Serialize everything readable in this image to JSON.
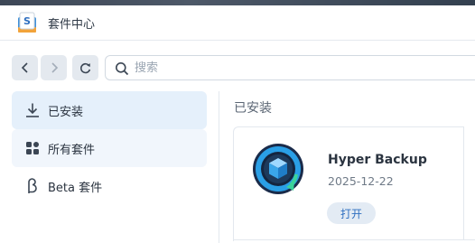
{
  "window": {
    "title": "套件中心"
  },
  "toolbar": {
    "search_placeholder": "搜索"
  },
  "sidebar": {
    "items": [
      {
        "label": "已安装",
        "icon": "download-icon",
        "state": "active"
      },
      {
        "label": "所有套件",
        "icon": "grid-icon",
        "state": "hover"
      },
      {
        "label": "Beta 套件",
        "icon": "beta-icon",
        "state": "normal"
      }
    ]
  },
  "main": {
    "section_title": "已安装",
    "packages": [
      {
        "name": "Hyper Backup",
        "date": "2025-12-22",
        "action_label": "打开",
        "icon": "hyper-backup-icon"
      }
    ]
  },
  "colors": {
    "accent": "#2f6fc0",
    "active_bg": "#e5f0fb",
    "button_bg": "#e3ebf4"
  }
}
